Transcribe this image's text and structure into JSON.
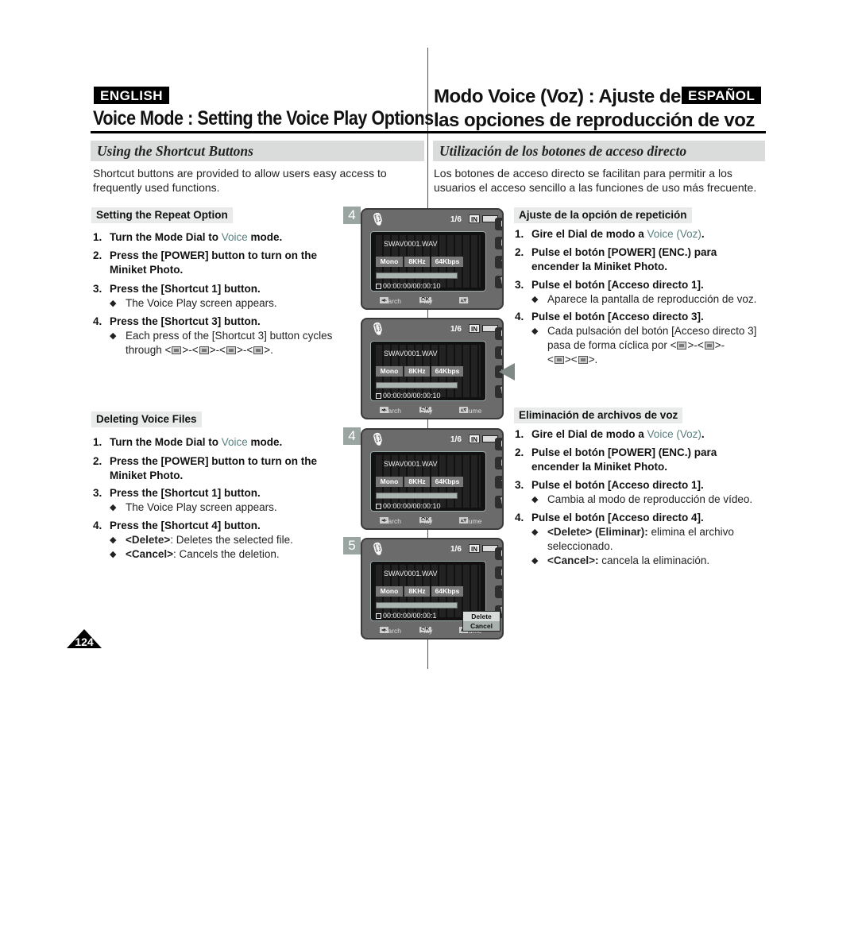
{
  "page_number": "124",
  "english": {
    "badge": "ENGLISH",
    "title": "Voice Mode : Setting the Voice Play Options",
    "subhead": "Using the Shortcut Buttons",
    "intro": "Shortcut buttons are provided to allow users easy access to frequently used functions.",
    "repeat": {
      "label": "Setting the Repeat Option",
      "steps": [
        {
          "num": "1.",
          "pre": "Turn the Mode Dial to ",
          "voice": "Voice",
          "post": " mode."
        },
        {
          "num": "2.",
          "text": "Press the [POWER] button to turn on the Miniket Photo."
        },
        {
          "num": "3.",
          "text": "Press the [Shortcut 1] button."
        },
        {
          "num": "4.",
          "text": "Press the [Shortcut 3] button."
        }
      ],
      "bullet3": "The Voice Play screen appears.",
      "bullet4_a": "Each press of the [Shortcut 3] button cycles",
      "bullet4_b": "through <",
      "sep": ">-<",
      "sep2": ">-<",
      "sep3": ">-<",
      "end": ">."
    },
    "delete": {
      "label": "Deleting Voice Files",
      "steps": [
        {
          "num": "1.",
          "pre": "Turn the Mode Dial to ",
          "voice": "Voice",
          "post": " mode."
        },
        {
          "num": "2.",
          "text": "Press the [POWER] button to turn on the Miniket Photo."
        },
        {
          "num": "3.",
          "text": "Press the [Shortcut 1] button."
        },
        {
          "num": "4.",
          "text": "Press the [Shortcut 4] button."
        }
      ],
      "bullet3": "The Voice Play screen appears.",
      "bullet_delete_key": "<Delete>",
      "bullet_delete_text": ": Deletes the selected file.",
      "bullet_cancel_key": "<Cancel>",
      "bullet_cancel_text": ": Cancels the deletion."
    }
  },
  "spanish": {
    "badge": "ESPAÑOL",
    "title_line1": "Modo Voice (Voz) : Ajuste de",
    "title_line2": "las opciones de reproducción de voz",
    "subhead": "Utilización de los botones de acceso directo",
    "intro": "Los botones de acceso directo se facilitan para permitir a los usuarios el acceso sencillo a las funciones de uso más frecuente.",
    "repeat": {
      "label": "Ajuste de la opción de repetición",
      "steps": [
        {
          "num": "1.",
          "pre": "Gire el Dial de modo a ",
          "voice": "Voice (Voz)",
          "post": "."
        },
        {
          "num": "2.",
          "text": "Pulse el botón [POWER] (ENC.) para encender la Miniket Photo."
        },
        {
          "num": "3.",
          "text": "Pulse el botón [Acceso directo 1]."
        },
        {
          "num": "4.",
          "text": "Pulse el botón [Acceso directo 3]."
        }
      ],
      "bullet3": "Aparece la pantalla de reproducción de voz.",
      "bullet4_a": "Cada pulsación del botón [Acceso directo 3]",
      "bullet4_b": "pasa de forma cíclica por <",
      "sep": ">-<",
      "end_line1": ">-",
      "line3_start": "<",
      "sep2": "><",
      "end": ">."
    },
    "delete": {
      "label": "Eliminación de archivos de voz",
      "steps": [
        {
          "num": "1.",
          "pre": "Gire el Dial de modo a ",
          "voice": "Voice (Voz)",
          "post": "."
        },
        {
          "num": "2.",
          "text": "Pulse el botón [POWER] (ENC.) para encender la Miniket Photo."
        },
        {
          "num": "3.",
          "text": "Pulse el botón [Acceso directo 1]."
        },
        {
          "num": "4.",
          "text": "Pulse el botón [Acceso directo 4]."
        }
      ],
      "bullet3": "Cambia al modo de reproducción de vídeo.",
      "bullet_delete_key": "<Delete> (Eliminar):",
      "bullet_delete_text": " elimina el archivo seleccionado.",
      "bullet_cancel_key": "<Cancel>:",
      "bullet_cancel_text": " cancela la eliminación."
    }
  },
  "screens": [
    {
      "step": "4",
      "count": "1/6",
      "in": "IN",
      "file": "SWAV0001.WAV",
      "mode": "Mono",
      "rate": "8KHz",
      "bitrate": "64Kbps",
      "time": "00:00:00/00:00:10",
      "search": "Search",
      "ok": "OK",
      "play": "Play",
      "vol": "Vol"
    },
    {
      "step": "",
      "count": "1/6",
      "in": "IN",
      "file": "SWAV0001.WAV",
      "mode": "Mono",
      "rate": "8KHz",
      "bitrate": "64Kbps",
      "time": "00:00:00/00:00:10",
      "search": "Search",
      "ok": "OK",
      "play": "Play",
      "vol": "Volume"
    },
    {
      "step": "4",
      "count": "1/6",
      "in": "IN",
      "file": "SWAV0001.WAV",
      "mode": "Mono",
      "rate": "8KHz",
      "bitrate": "64Kbps",
      "time": "00:00:00/00:00:10",
      "search": "Search",
      "ok": "OK",
      "play": "Play",
      "vol": "Volume"
    },
    {
      "step": "5",
      "count": "1/6",
      "in": "IN",
      "file": "SWAV0001.WAV",
      "mode": "Mono",
      "rate": "8KHz",
      "bitrate": "64Kbps",
      "time": "00:00:00/00:00:1",
      "search": "Search",
      "ok": "OK",
      "play": "Play",
      "vol": "Volume",
      "popup": [
        "Delete",
        "Cancel"
      ]
    }
  ],
  "icons": {
    "mic": "🎙",
    "play": "▶",
    "doc": "▤",
    "repeat": "⟲",
    "trash": "🗑",
    "bullet": "◆",
    "lr": "◂▸",
    "ud": "▴▾"
  }
}
